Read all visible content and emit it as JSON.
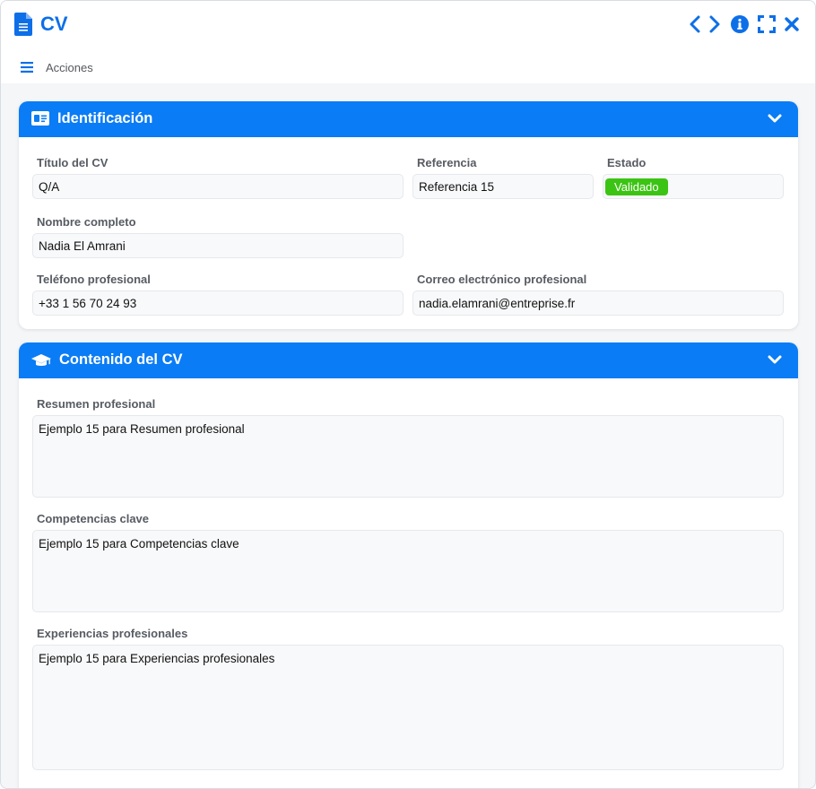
{
  "window": {
    "title": "CV",
    "actions_label": "Acciones"
  },
  "colors": {
    "accent": "#0a7cf5",
    "title": "#0d6fe8",
    "status_valid": "#3cc414"
  },
  "sections": {
    "identification": {
      "title": "Identificación",
      "fields": {
        "cv_title": {
          "label": "Título del CV",
          "value": "Q/A"
        },
        "reference": {
          "label": "Referencia",
          "value": "Referencia 15"
        },
        "status": {
          "label": "Estado",
          "value": "Validado"
        },
        "full_name": {
          "label": "Nombre completo",
          "value": "Nadia El Amrani"
        },
        "phone": {
          "label": "Teléfono profesional",
          "value": "+33 1 56 70 24 93"
        },
        "email": {
          "label": "Correo electrónico profesional",
          "value": "nadia.elamrani@entreprise.fr"
        }
      }
    },
    "content": {
      "title": "Contenido del CV",
      "fields": {
        "summary": {
          "label": "Resumen profesional",
          "value": "Ejemplo 15 para Resumen profesional"
        },
        "skills": {
          "label": "Competencias clave",
          "value": "Ejemplo 15 para Competencias clave"
        },
        "experience": {
          "label": "Experiencias profesionales",
          "value": "Ejemplo 15 para Experiencias profesionales"
        }
      }
    }
  }
}
